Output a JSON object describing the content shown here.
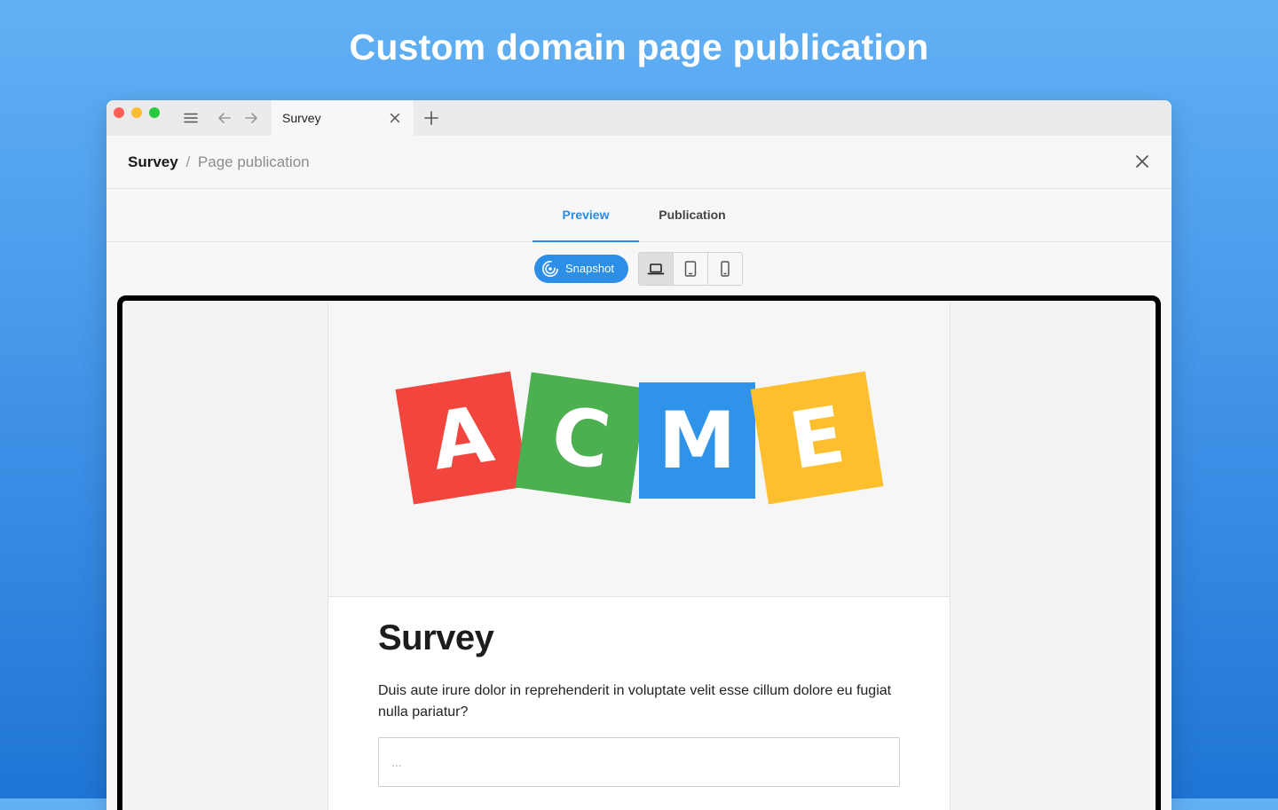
{
  "hero": {
    "title": "Custom domain page publication"
  },
  "browser": {
    "tab_title": "Survey"
  },
  "header": {
    "breadcrumb_main": "Survey",
    "breadcrumb_separator": "/",
    "breadcrumb_sub": "Page publication"
  },
  "tabs": [
    {
      "label": "Preview",
      "active": true
    },
    {
      "label": "Publication",
      "active": false
    }
  ],
  "toolbar": {
    "snapshot_label": "Snapshot",
    "devices": [
      "laptop",
      "tablet",
      "phone"
    ],
    "selected_device": "laptop"
  },
  "preview": {
    "logo": [
      {
        "letter": "A",
        "color": "#f1453d"
      },
      {
        "letter": "C",
        "color": "#4caf50"
      },
      {
        "letter": "M",
        "color": "#2f93ea"
      },
      {
        "letter": "E",
        "color": "#fdbf2d"
      }
    ],
    "survey_title": "Survey",
    "question": "Duis aute irure dolor in reprehenderit in voluptate velit esse cillum dolore eu fugiat nulla pariatur?",
    "input_placeholder": "..."
  },
  "colors": {
    "accent": "#2b8be6",
    "background_top": "#62b1f5",
    "background_bottom": "#1f75d4"
  }
}
